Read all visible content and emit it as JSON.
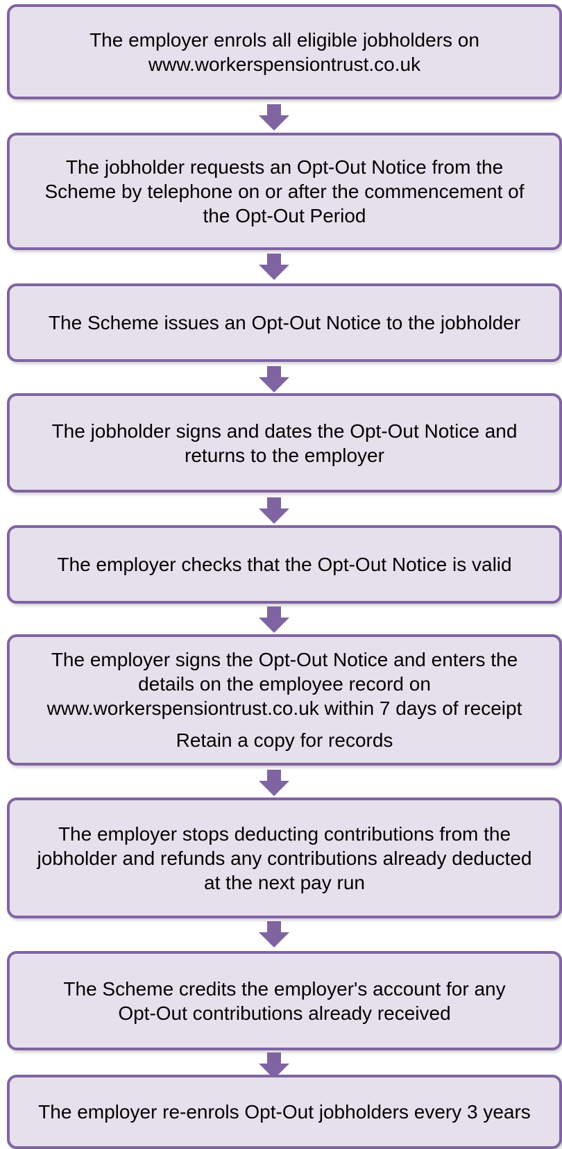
{
  "colors": {
    "box_fill": "#e6e0ec",
    "box_border": "#8064a2",
    "arrow": "#8064a2",
    "text": "#000000"
  },
  "steps": [
    {
      "lines": [
        "The employer enrols all eligible jobholders on",
        "www.workerspensiontrust.co.uk"
      ]
    },
    {
      "lines": [
        "The jobholder requests an Opt-Out Notice from the",
        "Scheme by telephone on or after the commencement of",
        "the Opt-Out Period"
      ]
    },
    {
      "lines": [
        "The Scheme issues an Opt-Out Notice to the jobholder"
      ]
    },
    {
      "lines": [
        "The jobholder signs and dates the Opt-Out Notice and",
        "returns to the employer"
      ]
    },
    {
      "lines": [
        "The employer checks that the Opt-Out Notice is valid"
      ]
    },
    {
      "lines": [
        "The employer signs the Opt-Out Notice and enters the",
        "details on the employee record on",
        "www.workerspensiontrust.co.uk within 7 days of receipt"
      ],
      "note": "Retain a copy for records"
    },
    {
      "lines": [
        "The employer stops deducting contributions from the",
        "jobholder and refunds any contributions already deducted",
        "at the next pay run"
      ]
    },
    {
      "lines": [
        "The Scheme credits the employer's account for any",
        "Opt-Out contributions already received"
      ]
    },
    {
      "lines": [
        "The employer re-enrols Opt-Out jobholders every 3 years"
      ]
    }
  ]
}
